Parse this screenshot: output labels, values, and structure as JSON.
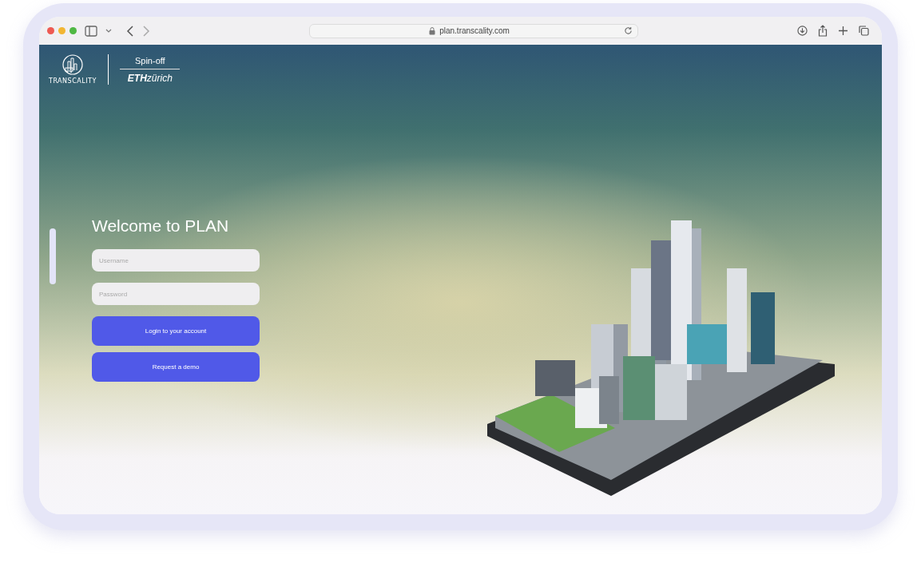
{
  "browser": {
    "url": "plan.transcality.com"
  },
  "header": {
    "logo_text": "TRANSCALITY",
    "spinoff": "Spin-off",
    "eth": "**ETH**zürich"
  },
  "login": {
    "title": "Welcome to PLAN",
    "fields": [
      {
        "placeholder": "Username"
      },
      {
        "placeholder": "Password"
      }
    ],
    "buttons": [
      "Login to your account",
      "Request a demo"
    ]
  }
}
